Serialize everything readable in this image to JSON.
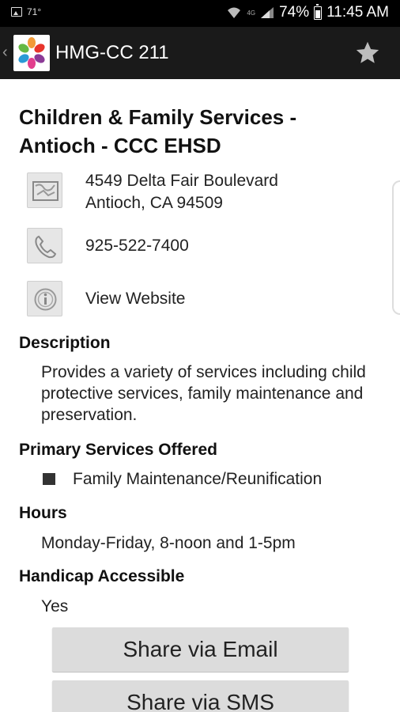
{
  "status_bar": {
    "temperature": "71°",
    "network": "4G",
    "battery": "74%",
    "time": "11:45 AM"
  },
  "app_bar": {
    "title": "HMG-CC 211"
  },
  "listing": {
    "name": "Children & Family Services - Antioch  - CCC EHSD",
    "address_line1": "4549 Delta Fair Boulevard",
    "address_line2": "Antioch, CA 94509",
    "phone": "925-522-7400",
    "website_label": "View Website"
  },
  "sections": {
    "description": {
      "heading": "Description",
      "text": "Provides a variety of services including child protective services, family maintenance and preservation."
    },
    "services": {
      "heading": "Primary Services Offered",
      "items": [
        "Family Maintenance/Reunification"
      ]
    },
    "hours": {
      "heading": "Hours",
      "text": "Monday-Friday, 8-noon and 1-5pm"
    },
    "accessible": {
      "heading": "Handicap Accessible",
      "text": "Yes"
    }
  },
  "actions": {
    "share_email": "Share via Email",
    "share_sms": "Share via SMS"
  },
  "icons": [
    "image-icon",
    "wifi-icon",
    "signal-icon",
    "battery-icon",
    "back-chevron-icon",
    "app-logo-icon",
    "star-icon",
    "map-icon",
    "phone-icon",
    "info-icon"
  ]
}
